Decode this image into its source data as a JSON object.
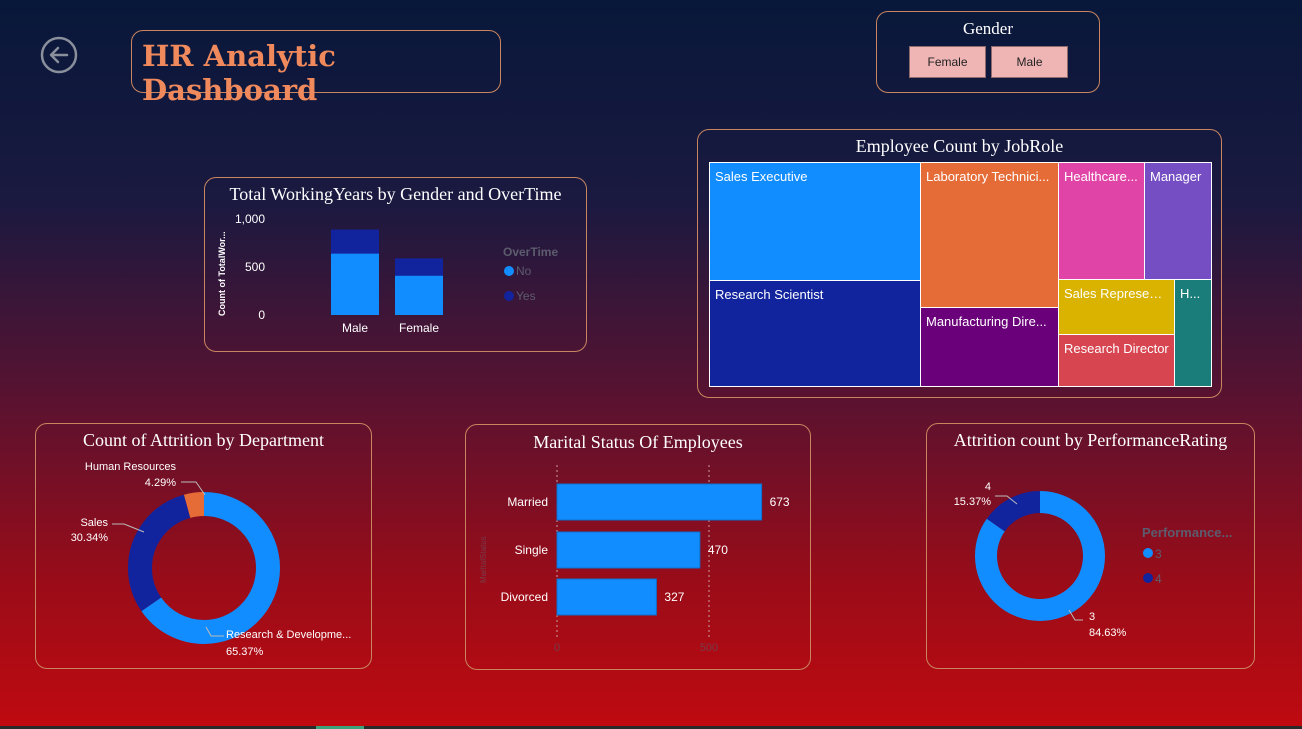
{
  "header": {
    "title": "HR Analytic Dashboard",
    "back_icon": "back-arrow-icon"
  },
  "gender_slicer": {
    "title": "Gender",
    "options": [
      "Female",
      "Male"
    ]
  },
  "working_years": {
    "title": "Total WorkingYears by Gender and OverTime",
    "ylabel": "Count of TotalWor...",
    "y_ticks": [
      "1,000",
      "500",
      "0"
    ],
    "legend_title": "OverTime",
    "legend": [
      "No",
      "Yes"
    ]
  },
  "jobrole": {
    "title": "Employee Count by JobRole",
    "labels": [
      "Sales Executive",
      "Laboratory Technici...",
      "Healthcare...",
      "Manager",
      "Research Scientist",
      "Manufacturing Dire...",
      "Sales Represent...",
      "H...",
      "Research Director"
    ]
  },
  "attrition_dept": {
    "title": "Count of Attrition by Department",
    "labels": [
      {
        "name": "Human Resources",
        "pct": "4.29%"
      },
      {
        "name": "Sales",
        "pct": "30.34%"
      },
      {
        "name": "Research & Developme...",
        "pct": "65.37%"
      }
    ]
  },
  "marital": {
    "title": "Marital Status Of Employees",
    "axis_label": "MaritalStatus",
    "categories": [
      "Married",
      "Single",
      "Divorced"
    ],
    "values": [
      "673",
      "470",
      "327"
    ],
    "x_ticks": [
      "0",
      "500"
    ]
  },
  "performance": {
    "title": "Attrition count by PerformanceRating",
    "legend_title": "Performance...",
    "legend": [
      "3",
      "4"
    ],
    "label_4": {
      "value": "4",
      "pct": "15.37%"
    },
    "label_3": {
      "value": "3",
      "pct": "84.63%"
    }
  },
  "colors": {
    "accent": "#f08a5d",
    "blue": "#118dff",
    "navy": "#12239e",
    "orange": "#e66c37"
  },
  "chart_data": [
    {
      "type": "bar",
      "title": "Total WorkingYears by Gender and OverTime",
      "categories": [
        "Male",
        "Female"
      ],
      "series": [
        {
          "name": "No",
          "values": [
            640,
            410
          ]
        },
        {
          "name": "Yes",
          "values": [
            250,
            180
          ]
        }
      ],
      "ylim": [
        0,
        1000
      ],
      "ylabel": "Count of TotalWor...",
      "legend": "right"
    },
    {
      "type": "pie",
      "title": "Count of Attrition by Department",
      "categories": [
        "Research & Developme...",
        "Sales",
        "Human Resources"
      ],
      "values": [
        65.37,
        30.34,
        4.29
      ]
    },
    {
      "type": "bar",
      "title": "Marital Status Of Employees",
      "categories": [
        "Married",
        "Single",
        "Divorced"
      ],
      "values": [
        673,
        470,
        327
      ],
      "orientation": "horizontal",
      "xlim": [
        0,
        700
      ]
    },
    {
      "type": "pie",
      "title": "Attrition count by PerformanceRating",
      "categories": [
        "3",
        "4"
      ],
      "values": [
        84.63,
        15.37
      ],
      "legend": "right"
    }
  ]
}
